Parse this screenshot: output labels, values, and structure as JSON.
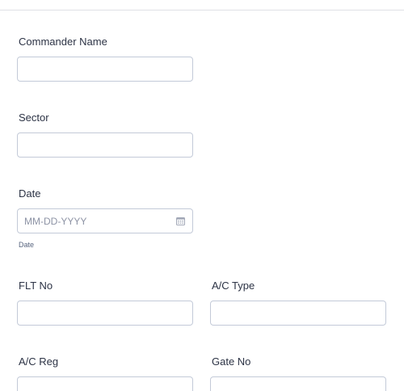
{
  "form": {
    "commander_name": {
      "label": "Commander Name",
      "value": ""
    },
    "sector": {
      "label": "Sector",
      "value": ""
    },
    "date": {
      "label": "Date",
      "placeholder": "MM-DD-YYYY",
      "sublabel": "Date",
      "icon": "calendar-icon"
    },
    "flt_no": {
      "label": "FLT No",
      "value": ""
    },
    "ac_type": {
      "label": "A/C Type",
      "value": ""
    },
    "ac_reg": {
      "label": "A/C Reg",
      "value": ""
    },
    "gate_no": {
      "label": "Gate No",
      "value": ""
    }
  },
  "colors": {
    "label_text": "#2c3345",
    "input_border": "#c3cad8",
    "placeholder_text": "#8d93a5",
    "divider": "#dfe1e6"
  }
}
